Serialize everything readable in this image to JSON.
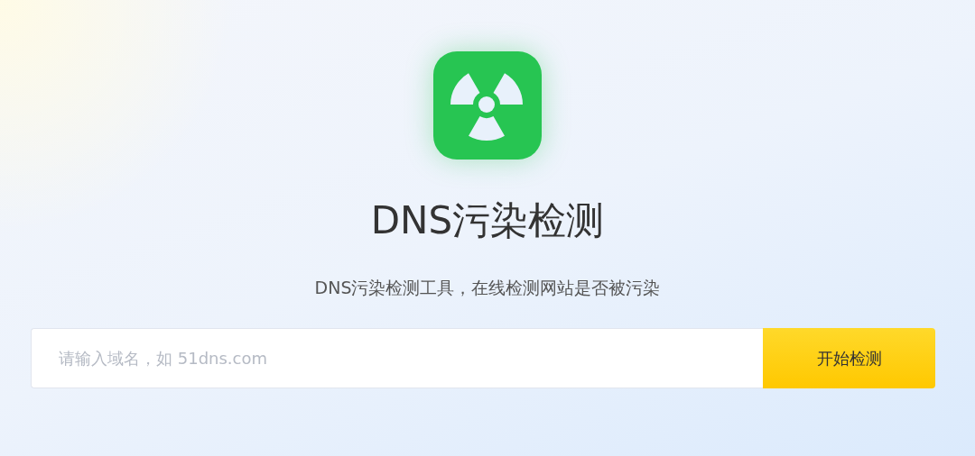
{
  "title": "DNS污染检测",
  "subtitle": "DNS污染检测工具，在线检测网站是否被污染",
  "search": {
    "placeholder": "请输入域名，如 51dns.com"
  },
  "button": "开始检测"
}
